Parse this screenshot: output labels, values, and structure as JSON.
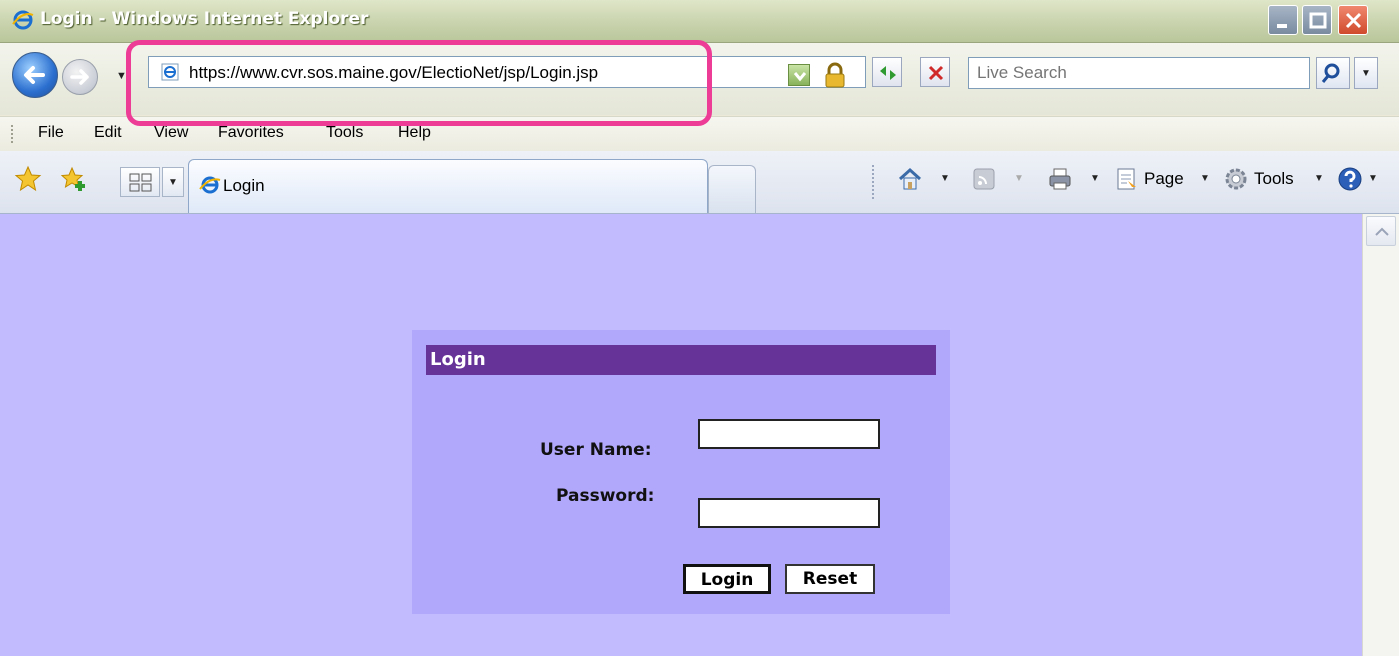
{
  "window": {
    "title": "Login - Windows Internet Explorer"
  },
  "address_bar": {
    "url": "https://www.cvr.sos.maine.gov/ElectioNet/jsp/Login.jsp"
  },
  "search": {
    "placeholder": "Live Search"
  },
  "menu": {
    "items": [
      "File",
      "Edit",
      "View",
      "Favorites",
      "Tools",
      "Help"
    ]
  },
  "tabs": [
    {
      "label": "Login",
      "active": true
    }
  ],
  "command_bar": {
    "page_label": "Page",
    "tools_label": "Tools"
  },
  "login_form": {
    "header": "Login",
    "username_label": "User Name:",
    "password_label": "Password:",
    "username_value": "",
    "password_value": "",
    "login_button": "Login",
    "reset_button": "Reset"
  },
  "colors": {
    "page_background": "#c2bcff",
    "panel_background": "#b1a8fc",
    "header_background": "#663399",
    "highlight": "#ec3c96"
  }
}
